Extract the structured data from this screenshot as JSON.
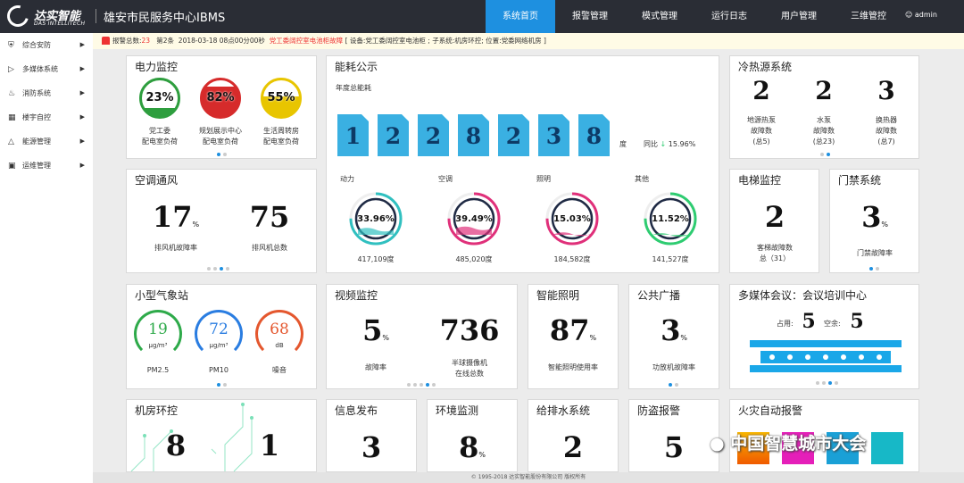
{
  "header": {
    "logo_cn": "达实智能",
    "logo_en": "DAS INTELLITECH",
    "app_title": "雄安市民服务中心IBMS",
    "user": "admin",
    "nav": [
      "系统首页",
      "报警管理",
      "模式管理",
      "运行日志",
      "用户管理",
      "三维管控"
    ]
  },
  "alert": {
    "label": "报警总数:",
    "count": "23",
    "page": "第2条",
    "time": "2018-03-18 08点00分00秒",
    "message": "党工委阔控室电池柜故障",
    "detail": "[ 设备:党工委阔控室电池柜 ;  子系统:机房环控;  位置:党委网络机房 ]"
  },
  "sidebar": {
    "items": [
      "综合安防",
      "多媒体系统",
      "消防系统",
      "楼宇自控",
      "能源管理",
      "运维管理"
    ]
  },
  "power": {
    "title": "电力监控",
    "items": [
      {
        "value": "23%",
        "l1": "党工委",
        "l2": "配电室负荷",
        "color": "#2e9e3e",
        "level": 0.23
      },
      {
        "value": "82%",
        "l1": "规划展示中心",
        "l2": "配电室负荷",
        "color": "#d62b2b",
        "level": 0.82
      },
      {
        "value": "55%",
        "l1": "生活周转房",
        "l2": "配电室负荷",
        "color": "#e8c500",
        "level": 0.55
      }
    ]
  },
  "energy": {
    "title": "能耗公示",
    "subtitle": "年度总能耗",
    "digits": [
      "1",
      "2",
      "2",
      "8",
      "2",
      "3",
      "8"
    ],
    "unit": "度",
    "yoy_label": "同比",
    "yoy_value": "15.96%",
    "arrow": "↓",
    "cats": [
      {
        "name": "动力",
        "pct": "33.96%",
        "val": "417,109度",
        "color": "#30c0c0",
        "level": 0.3396
      },
      {
        "name": "空调",
        "pct": "39.49%",
        "val": "485,020度",
        "color": "#e0307a",
        "level": 0.3949
      },
      {
        "name": "照明",
        "pct": "15.03%",
        "val": "184,582度",
        "color": "#e0307a",
        "level": 0.1503
      },
      {
        "name": "其他",
        "pct": "11.52%",
        "val": "141,527度",
        "color": "#2ecc71",
        "level": 0.1152
      }
    ]
  },
  "hvac_src": {
    "title": "冷热源系统",
    "items": [
      {
        "num": "2",
        "l1": "地源热泵",
        "l2": "故障数",
        "l3": "(总5)"
      },
      {
        "num": "2",
        "l1": "水泵",
        "l2": "故障数",
        "l3": "(总23)"
      },
      {
        "num": "3",
        "l1": "换热器",
        "l2": "故障数",
        "l3": "(总7)"
      }
    ]
  },
  "aircon": {
    "title": "空调通风",
    "a_num": "17",
    "a_unit": "%",
    "a_label": "排风机故障率",
    "b_num": "75",
    "b_label": "排风机总数"
  },
  "elevator": {
    "title": "电梯监控",
    "num": "2",
    "l1": "客梯故障数",
    "l2": "总（31）"
  },
  "access": {
    "title": "门禁系统",
    "num": "3",
    "unit": "%",
    "label": "门禁故障率"
  },
  "weather": {
    "title": "小型气象站",
    "items": [
      {
        "val": "19",
        "unit": "μg/m³",
        "name": "PM2.5",
        "color": "#2eaa4a"
      },
      {
        "val": "72",
        "unit": "μg/m³",
        "name": "PM10",
        "color": "#2a7de1"
      },
      {
        "val": "68",
        "unit": "dB",
        "name": "噪音",
        "color": "#e4572e"
      }
    ]
  },
  "video": {
    "title": "视频监控",
    "a_num": "5",
    "a_unit": "%",
    "a_label": "故障率",
    "b_num": "736",
    "b_l1": "半球摄像机",
    "b_l2": "在线总数"
  },
  "lighting": {
    "title": "智能照明",
    "num": "87",
    "unit": "%",
    "label": "智能照明使用率"
  },
  "broadcast": {
    "title": "公共广播",
    "num": "3",
    "unit": "%",
    "label": "功放机故障率"
  },
  "meeting": {
    "title": "多媒体会议：会议培训中心",
    "used_label": "占用:",
    "used": "5",
    "free_label": "空余:",
    "free": "5"
  },
  "machine": {
    "title": "机房环控",
    "a": "8",
    "b": "1"
  },
  "info": {
    "title": "信息发布",
    "num": "3"
  },
  "env": {
    "title": "环境监测",
    "num": "8",
    "unit": "%"
  },
  "water": {
    "title": "给排水系统",
    "num": "2"
  },
  "antitheft": {
    "title": "防盗报警",
    "num": "5"
  },
  "fire": {
    "title": "火灾自动报警"
  },
  "footer": "© 1995-2018 达实智能股份有限公司 版权所有",
  "watermark": "中国智慧城市大会"
}
